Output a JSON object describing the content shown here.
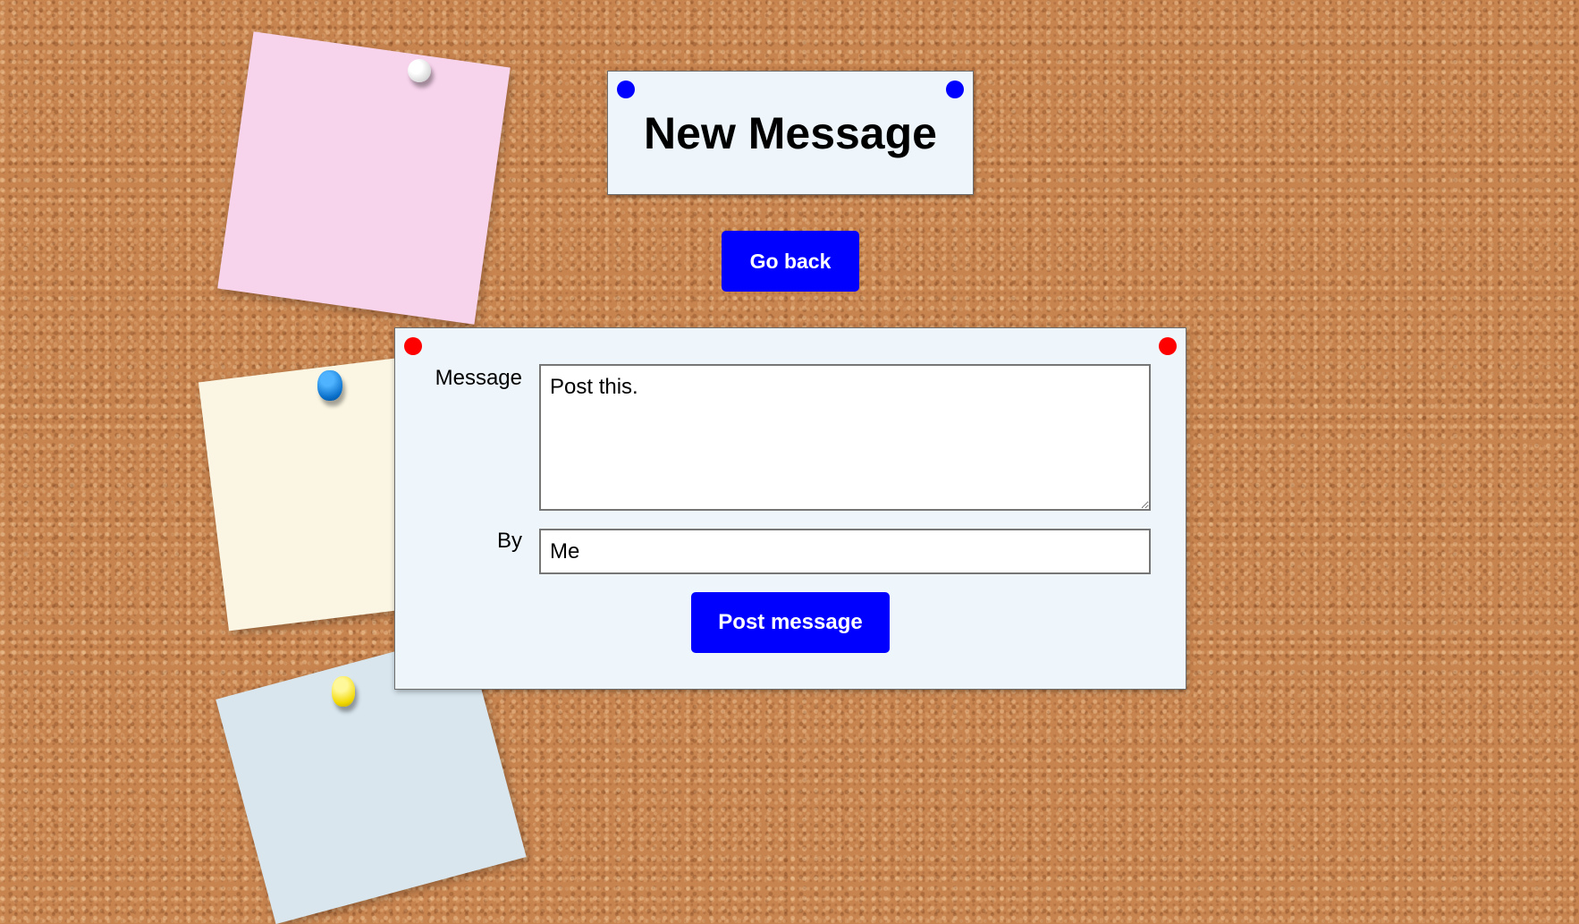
{
  "header": {
    "title": "New Message"
  },
  "nav": {
    "back_label": "Go back"
  },
  "form": {
    "message_label": "Message",
    "message_value": "Post this.",
    "by_label": "By",
    "by_value": "Me",
    "submit_label": "Post message"
  },
  "colors": {
    "button": "#0000ff",
    "card": "#eef6fc",
    "title_pins": "#0000ff",
    "form_pins": "#ff0000",
    "board": "#c8844f"
  },
  "decorations": {
    "sticky_notes": [
      "pink",
      "cream",
      "light-blue"
    ],
    "push_pins": [
      "white",
      "blue",
      "yellow"
    ]
  }
}
